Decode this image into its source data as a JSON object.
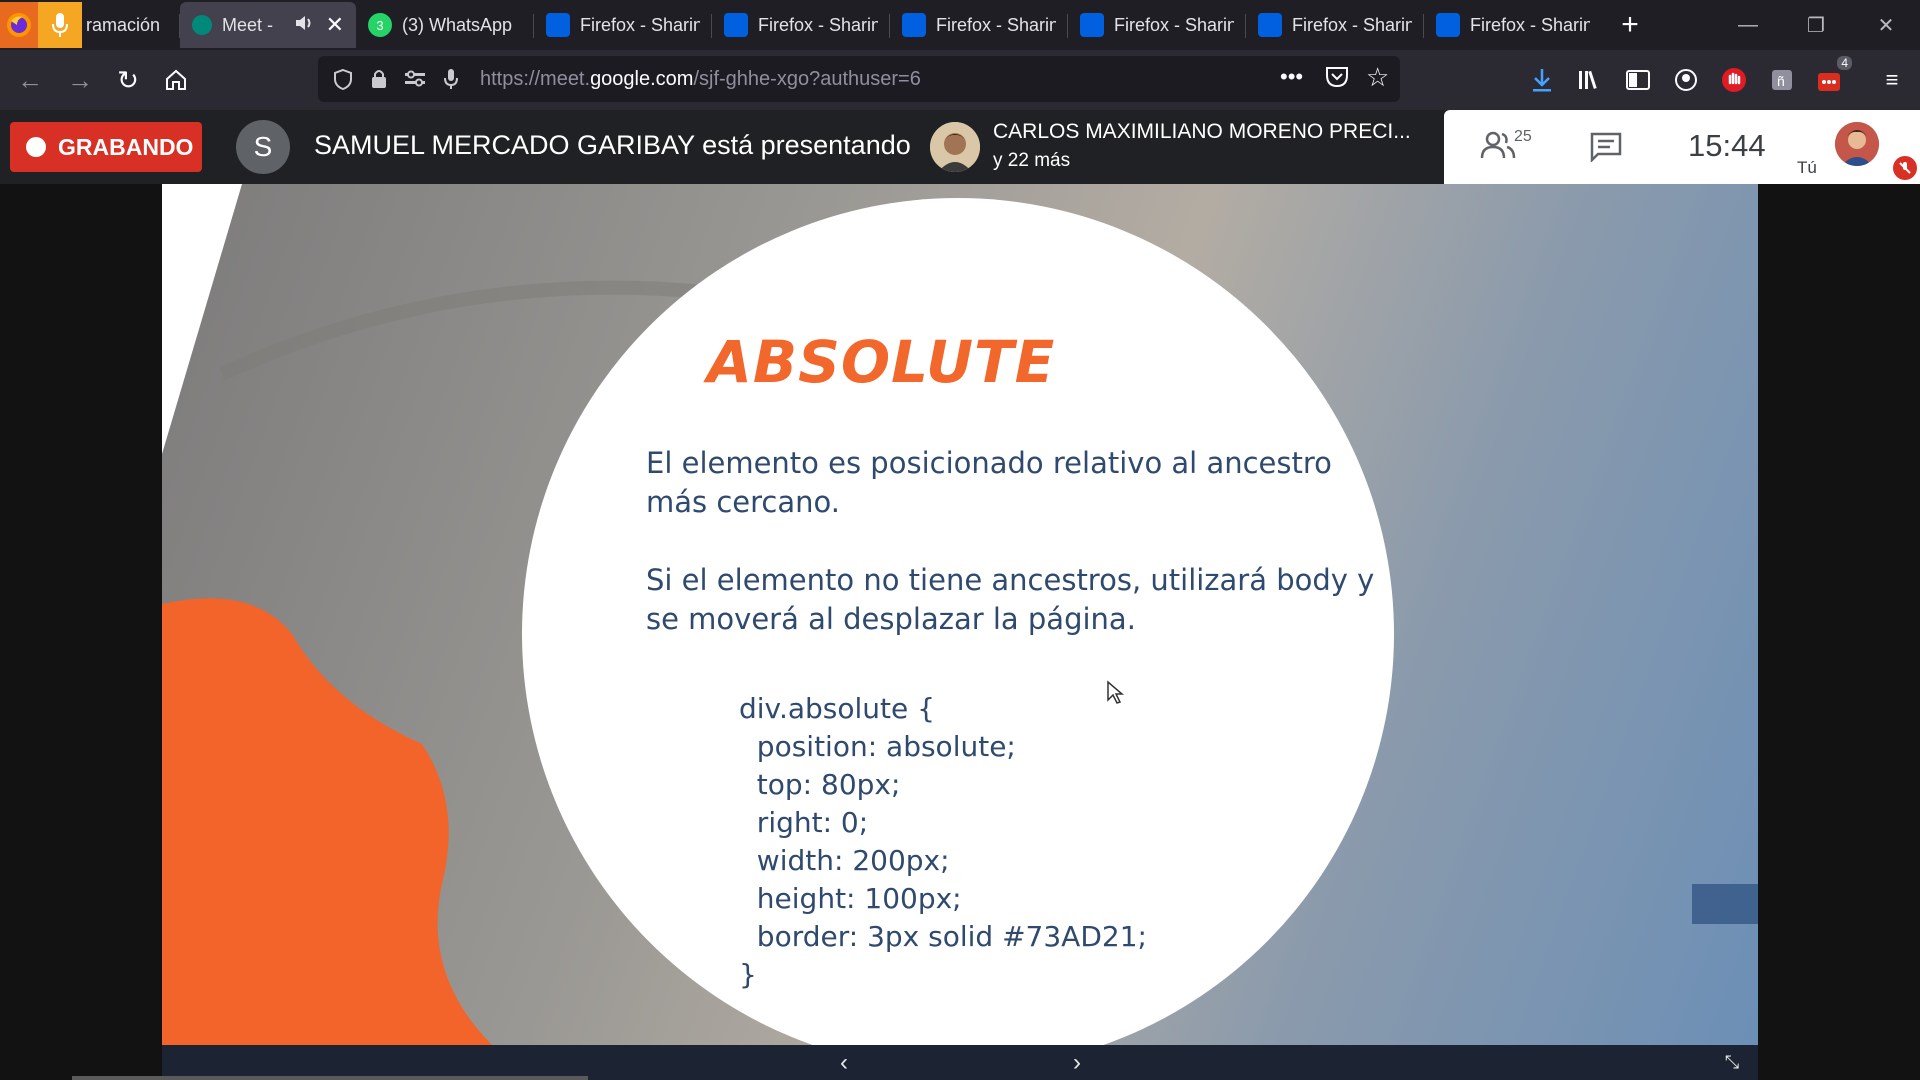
{
  "browser": {
    "tabs": [
      {
        "label": "ramación",
        "icon": "microphone-icon"
      },
      {
        "label": "Meet - ",
        "icon": "google-meet-icon",
        "active": true
      },
      {
        "label": "(3) WhatsApp",
        "icon": "whatsapp-icon"
      },
      {
        "label": "Firefox - Sharin",
        "icon": "firefox-send-icon"
      },
      {
        "label": "Firefox - Sharin",
        "icon": "firefox-send-icon"
      },
      {
        "label": "Firefox - Sharin",
        "icon": "firefox-send-icon"
      },
      {
        "label": "Firefox - Sharin",
        "icon": "firefox-send-icon"
      },
      {
        "label": "Firefox - Sharin",
        "icon": "firefox-send-icon"
      },
      {
        "label": "Firefox - Sharin",
        "icon": "firefox-send-icon"
      }
    ],
    "whatsapp_badge": "3",
    "url_prefix": "https://meet.",
    "url_domain": "google.com",
    "url_path": "/sjf-ghhe-xgo?authuser=6",
    "extension_badge": "4"
  },
  "meet": {
    "recording_label": "GRABANDO",
    "presenter_initial": "S",
    "presenting_text": "SAMUEL MERCADO GARIBAY está presentando",
    "speaker_name": "CARLOS MAXIMILIANO MORENO PRECI...",
    "speaker_more": "y 22 más",
    "participant_count": "25",
    "clock": "15:44",
    "self_label": "Tú"
  },
  "slide": {
    "title": "ABSOLUTE",
    "paragraph1_line1": "El elemento es posicionado relativo al ancestro",
    "paragraph1_line2": "más cercano.",
    "paragraph2_line1": "Si el elemento no tiene ancestros, utilizará body y",
    "paragraph2_line2": "se moverá al desplazar la página.",
    "code": "div.absolute {\n  position: absolute;\n  top: 80px;\n  right: 0;\n  width: 200px;\n  height: 100px;\n  border: 3px solid #73AD21;\n}"
  },
  "colors": {
    "recording": "#d93025",
    "slide_title": "#f2672b",
    "slide_text": "#2f4a6e",
    "firefox_tab_accent": "#e86a1e"
  }
}
